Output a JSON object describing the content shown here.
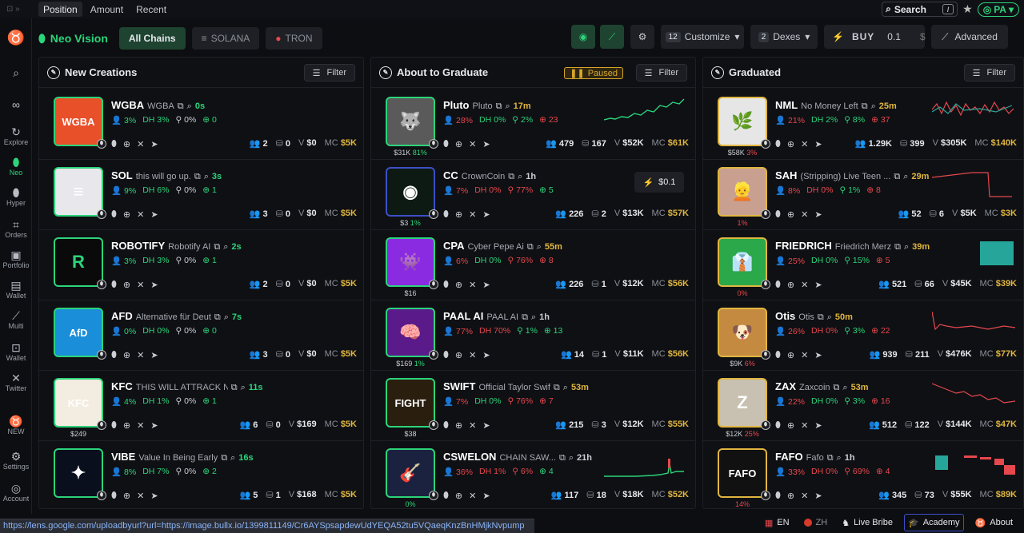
{
  "top_tabs": [
    "Position",
    "Amount",
    "Recent"
  ],
  "search": {
    "label": "Search",
    "shortcut": "/"
  },
  "user": {
    "initials": "PA"
  },
  "sidebar": [
    {
      "label": "",
      "icon": "search-icon"
    },
    {
      "label": "",
      "icon": "link-icon"
    },
    {
      "label": "Explore",
      "icon": "explore-icon"
    },
    {
      "label": "Neo",
      "icon": "neo-icon"
    },
    {
      "label": "Hyper",
      "icon": "hyper-icon"
    },
    {
      "label": "Orders",
      "icon": "orders-icon"
    },
    {
      "label": "Portfolio",
      "icon": "portfolio-icon"
    },
    {
      "label": "Wallet",
      "icon": "wallet-icon"
    },
    {
      "label": "Multi",
      "icon": "multi-icon"
    },
    {
      "label": "Wallet",
      "icon": "wallet2-icon"
    },
    {
      "label": "Twitter",
      "icon": "twitter-icon"
    },
    {
      "label": "NEW",
      "icon": "new-icon"
    },
    {
      "label": "Settings",
      "icon": "settings-icon"
    },
    {
      "label": "Account",
      "icon": "account-icon"
    }
  ],
  "header": {
    "brand": "Neo Vision",
    "chains": [
      "All Chains",
      "SOLANA",
      "TRON"
    ],
    "customize": {
      "count": "12",
      "label": "Customize"
    },
    "dexes": {
      "count": "2",
      "label": "Dexes"
    },
    "buy": {
      "label": "BUY",
      "amount": "0.1",
      "unit": "$"
    },
    "advanced": "Advanced"
  },
  "columns": [
    {
      "title": "New Creations",
      "filter": "Filter",
      "rows": [
        {
          "ticker": "WGBA",
          "name": "WGBA",
          "age": "0s",
          "s1": "3%",
          "s2": "3%",
          "s3": "0%",
          "s4": "0",
          "holders": "2",
          "buys": "0",
          "vol": "$0",
          "mc": "$5K",
          "sub": "",
          "avatar": "WGBA"
        },
        {
          "ticker": "SOL",
          "name": "this will go up.",
          "age": "3s",
          "s1": "9%",
          "s2": "6%",
          "s3": "0%",
          "s4": "1",
          "holders": "3",
          "buys": "0",
          "vol": "$0",
          "mc": "$5K",
          "sub": "",
          "avatar": "≡"
        },
        {
          "ticker": "ROBOTIFY",
          "name": "Robotify AI",
          "age": "2s",
          "s1": "3%",
          "s2": "3%",
          "s3": "0%",
          "s4": "1",
          "holders": "2",
          "buys": "0",
          "vol": "$0",
          "mc": "$5K",
          "sub": "",
          "avatar": "R"
        },
        {
          "ticker": "AFD",
          "name": "Alternative für Deut",
          "age": "7s",
          "s1": "0%",
          "s2": "0%",
          "s3": "0%",
          "s4": "0",
          "holders": "3",
          "buys": "0",
          "vol": "$0",
          "mc": "$5K",
          "sub": "",
          "avatar": "AfD"
        },
        {
          "ticker": "KFC",
          "name": "THIS WILL ATTRACK NI",
          "age": "11s",
          "s1": "4%",
          "s2": "1%",
          "s3": "0%",
          "s4": "1",
          "holders": "6",
          "buys": "0",
          "vol": "$169",
          "mc": "$5K",
          "sub": "$249",
          "avatar": "KFC"
        },
        {
          "ticker": "VIBE",
          "name": "Value In Being Early",
          "age": "16s",
          "s1": "8%",
          "s2": "7%",
          "s3": "0%",
          "s4": "2",
          "holders": "5",
          "buys": "1",
          "vol": "$168",
          "mc": "$5K",
          "sub": "",
          "avatar": "✦"
        }
      ]
    },
    {
      "title": "About to Graduate",
      "paused": "Paused",
      "filter": "Filter",
      "rows": [
        {
          "ticker": "Pluto",
          "name": "Pluto",
          "age": "17m",
          "s1": "28%",
          "s2": "0%",
          "s3": "2%",
          "s4": "23",
          "holders": "479",
          "buys": "167",
          "vol": "$52K",
          "mc": "$61K",
          "sub": "$31K",
          "subpct": "81%",
          "avatar": "🐺"
        },
        {
          "ticker": "CC",
          "name": "CrownCoin",
          "age": "1h",
          "s1": "7%",
          "s2": "0%",
          "s3": "77%",
          "s4": "5",
          "holders": "226",
          "buys": "2",
          "vol": "$13K",
          "mc": "$57K",
          "sub": "$3",
          "subpct": "1%",
          "price": "$0.1",
          "avatar": "◉"
        },
        {
          "ticker": "CPA",
          "name": "Cyber Pepe Ai",
          "age": "55m",
          "s1": "6%",
          "s2": "0%",
          "s3": "76%",
          "s4": "8",
          "holders": "226",
          "buys": "1",
          "vol": "$12K",
          "mc": "$56K",
          "sub": "$16",
          "subpct": "",
          "avatar": "👾"
        },
        {
          "ticker": "PAAL AI",
          "name": "PAAL AI",
          "age": "1h",
          "s1": "77%",
          "s2": "70%",
          "s3": "1%",
          "s4": "13",
          "holders": "14",
          "buys": "1",
          "vol": "$11K",
          "mc": "$56K",
          "sub": "$169",
          "subpct": "1%",
          "avatar": "🧠"
        },
        {
          "ticker": "SWIFT",
          "name": "Official Taylor Swif",
          "age": "53m",
          "s1": "7%",
          "s2": "0%",
          "s3": "76%",
          "s4": "7",
          "holders": "215",
          "buys": "3",
          "vol": "$12K",
          "mc": "$55K",
          "sub": "$38",
          "subpct": "",
          "avatar": "FIGHT"
        },
        {
          "ticker": "CSWELON",
          "name": "CHAIN SAW...",
          "age": "21h",
          "s1": "36%",
          "s2": "1%",
          "s3": "6%",
          "s4": "4",
          "holders": "117",
          "buys": "18",
          "vol": "$18K",
          "mc": "$52K",
          "sub": "",
          "subpct": "0%",
          "avatar": "🎸"
        }
      ]
    },
    {
      "title": "Graduated",
      "filter": "Filter",
      "rows": [
        {
          "ticker": "NML",
          "name": "No Money Left",
          "age": "25m",
          "s1": "21%",
          "s2": "2%",
          "s3": "8%",
          "s4": "37",
          "holders": "1.29K",
          "buys": "399",
          "vol": "$305K",
          "mc": "$140K",
          "sub": "$58K",
          "subpct": "3%",
          "avatar": "🌿"
        },
        {
          "ticker": "SAH",
          "name": "(Stripping) Live Teen ...",
          "age": "29m",
          "s1": "8%",
          "s2": "0%",
          "s3": "1%",
          "s4": "8",
          "holders": "52",
          "buys": "6",
          "vol": "$5K",
          "mc": "$3K",
          "sub": "",
          "subpct": "1%",
          "avatar": "👱"
        },
        {
          "ticker": "FRIEDRICH",
          "name": "Friedrich Merz",
          "age": "39m",
          "s1": "25%",
          "s2": "0%",
          "s3": "15%",
          "s4": "5",
          "holders": "521",
          "buys": "66",
          "vol": "$45K",
          "mc": "$39K",
          "sub": "",
          "subpct": "0%",
          "avatar": "👔"
        },
        {
          "ticker": "Otis",
          "name": "Otis",
          "age": "50m",
          "s1": "26%",
          "s2": "0%",
          "s3": "3%",
          "s4": "22",
          "holders": "939",
          "buys": "211",
          "vol": "$476K",
          "mc": "$77K",
          "sub": "$9K",
          "subpct": "6%",
          "avatar": "🐶"
        },
        {
          "ticker": "ZAX",
          "name": "Zaxcoin",
          "age": "53m",
          "s1": "22%",
          "s2": "0%",
          "s3": "3%",
          "s4": "16",
          "holders": "512",
          "buys": "122",
          "vol": "$144K",
          "mc": "$47K",
          "sub": "$12K",
          "subpct": "25%",
          "avatar": "Z"
        },
        {
          "ticker": "FAFO",
          "name": "Fafo",
          "age": "1h",
          "s1": "33%",
          "s2": "0%",
          "s3": "69%",
          "s4": "4",
          "holders": "345",
          "buys": "73",
          "vol": "$55K",
          "mc": "$89K",
          "sub": "",
          "subpct": "14%",
          "avatar": "FAFO"
        }
      ]
    }
  ],
  "status_url": "https://lens.google.com/uploadbyurl?url=https://image.bullx.io/1399811149/Cr6AYSpsapdewUdYEQA52tu5VQaeqKnzBnHMjkNvpump",
  "footer": {
    "en": "EN",
    "zh": "ZH",
    "bribe": "Live Bribe",
    "academy": "Academy",
    "about": "About"
  },
  "colors": {
    "green": "#2cd47a",
    "red": "#e5484d",
    "gold": "#e0b640",
    "bg": "#0d0e12"
  }
}
